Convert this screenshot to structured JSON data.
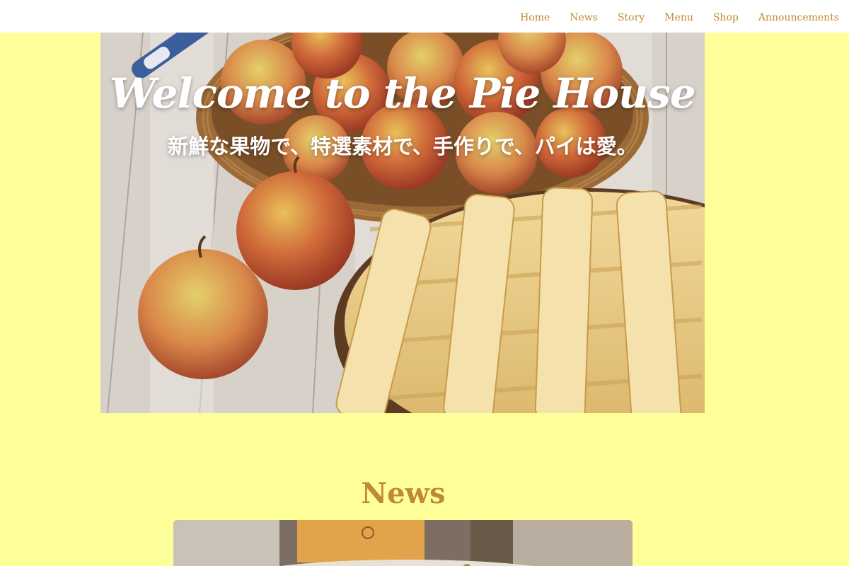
{
  "nav": {
    "items": [
      {
        "label": "Home"
      },
      {
        "label": "News"
      },
      {
        "label": "Story"
      },
      {
        "label": "Menu"
      },
      {
        "label": "Shop"
      },
      {
        "label": "Announcements"
      }
    ]
  },
  "hero": {
    "title": "Welcome to the Pie House",
    "subtitle": "新鮮な果物で、特選素材で、手作りで、パイは愛。",
    "image_subject": "apples-and-lattice-pie-photo"
  },
  "news": {
    "heading": "News",
    "card_image_subject": "news-photo"
  },
  "colors": {
    "page_background": "#ffff99",
    "accent": "#c08a34",
    "nav_background": "#ffffff"
  }
}
